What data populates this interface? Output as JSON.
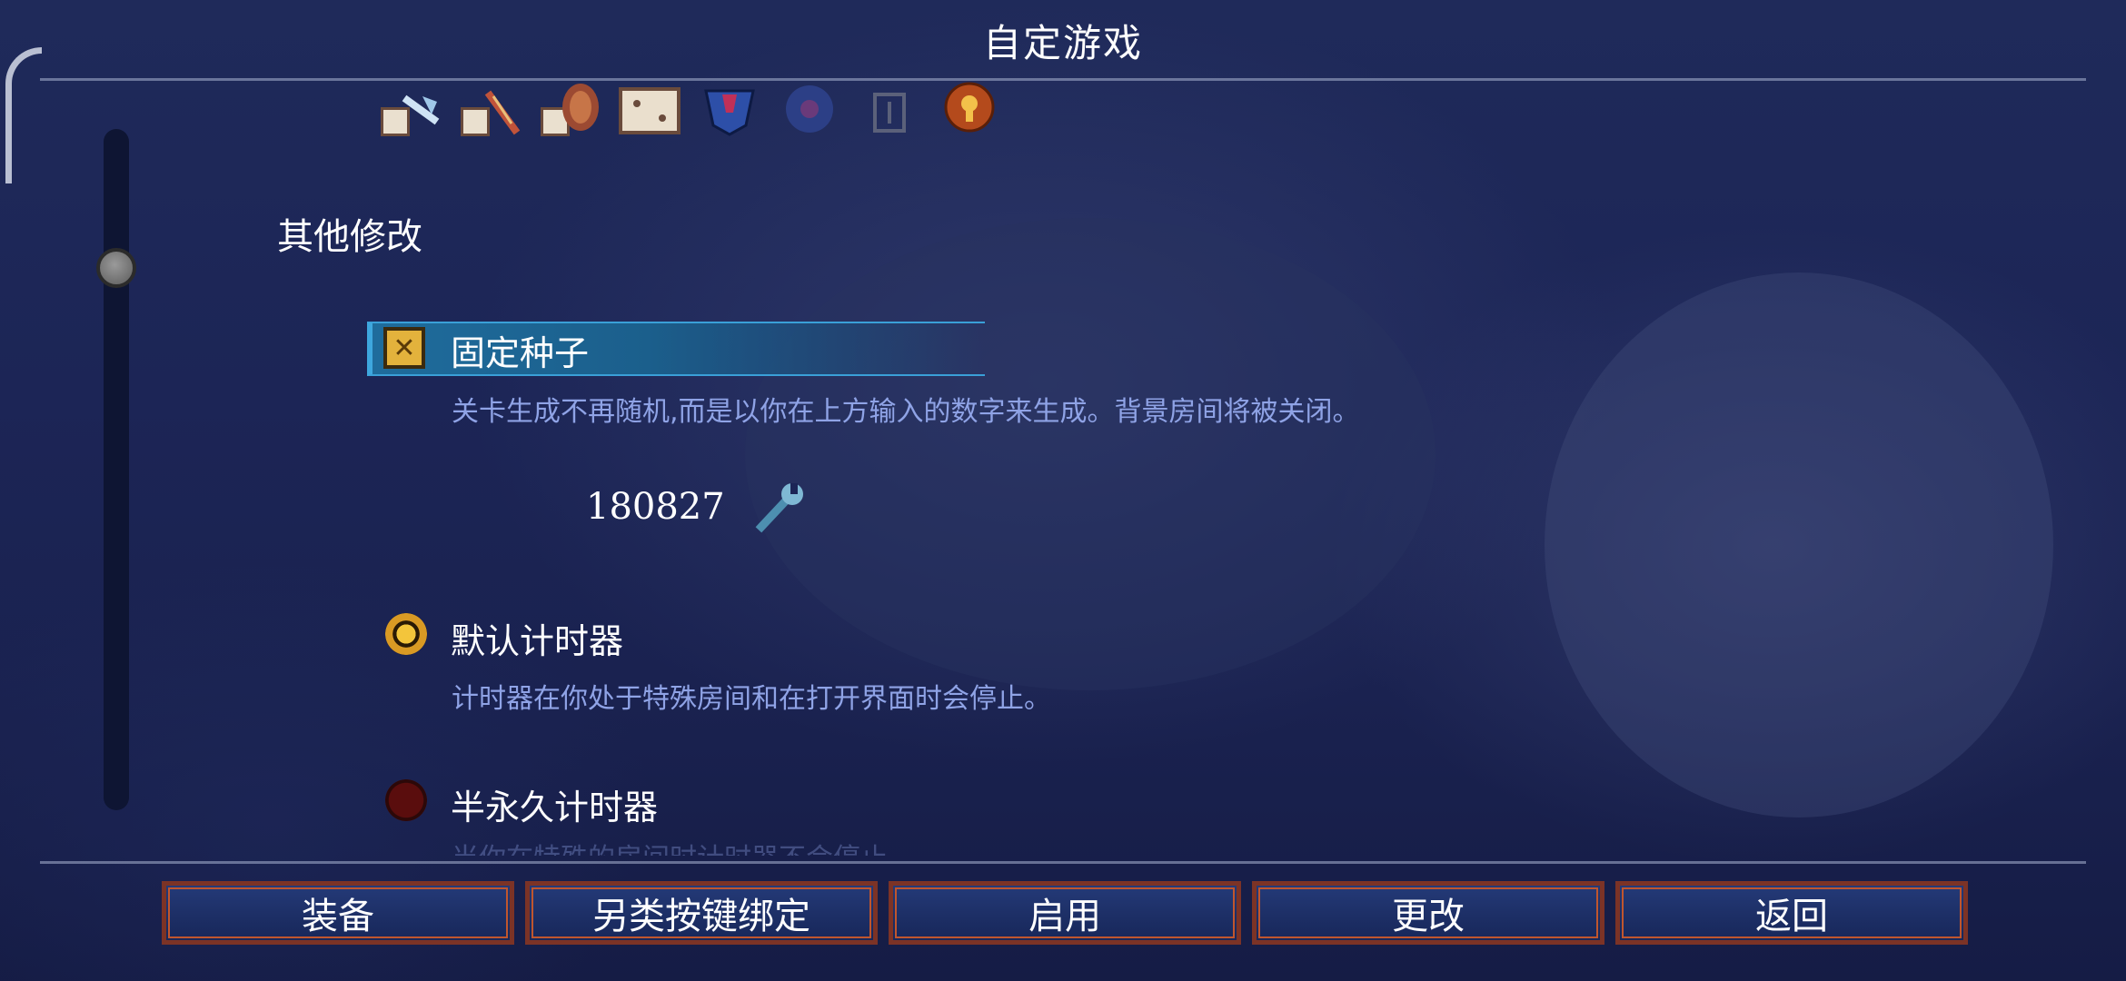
{
  "header": {
    "title": "自定游戏"
  },
  "mods": {
    "section_title": "其他修改",
    "icons": [
      "dice-axe-icon",
      "dice-bow-icon",
      "dice-shield-icon",
      "dice-box-icon",
      "blue-gem-icon",
      "blue-disc-icon",
      "grey-lock-icon",
      "keyhole-badge-icon"
    ],
    "options": [
      {
        "label": "固定种子",
        "desc": "关卡生成不再随机,而是以你在上方输入的数字来生成。背景房间将被关闭。",
        "state": "checked"
      },
      {
        "label": "默认计时器",
        "desc": "计时器在你处于特殊房间和在打开界面时会停止。",
        "state": "selected"
      },
      {
        "label": "半永久计时器",
        "desc": "当你在特殊的房间时计时器不会停止。",
        "state": "unselected"
      }
    ],
    "seed_value": "180827"
  },
  "colors": {
    "accent": "#3ea7de",
    "desc_text": "#8fa3e6",
    "button_border": "#7c3326"
  },
  "footer": {
    "buttons": [
      "装备",
      "另类按键绑定",
      "启用",
      "更改",
      "返回"
    ]
  }
}
